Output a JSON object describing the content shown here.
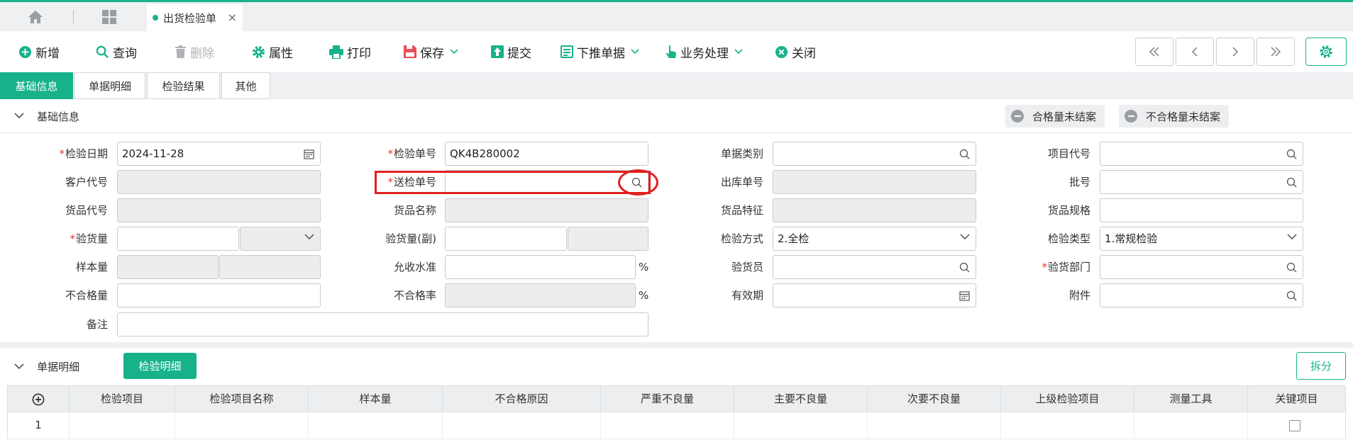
{
  "colors": {
    "accent": "#17b28a",
    "required": "#e53935",
    "highlight": "#e02020"
  },
  "tabbar": {
    "home_icon": "home-icon",
    "apps_icon": "grid-icon",
    "document_tab": {
      "label": "出货检验单",
      "close": "×"
    }
  },
  "toolbar": {
    "new": "新增",
    "query": "查询",
    "delete": "删除",
    "properties": "属性",
    "print": "打印",
    "save": "保存",
    "submit": "提交",
    "push_down": "下推单据",
    "business": "业务处理",
    "close": "关闭"
  },
  "subtabs": [
    "基础信息",
    "单据明细",
    "检验结果",
    "其他"
  ],
  "basic": {
    "title": "基础信息",
    "status_pass": "合格量未结案",
    "status_fail": "不合格量未结案"
  },
  "fields": {
    "inspect_date": {
      "label": "检验日期",
      "value": "2024-11-28"
    },
    "inspect_no": {
      "label": "检验单号",
      "value": "QK4B280002"
    },
    "doc_type": {
      "label": "单据类别",
      "value": ""
    },
    "project_code": {
      "label": "项目代号",
      "value": ""
    },
    "customer_code": {
      "label": "客户代号",
      "value": ""
    },
    "submit_no": {
      "label": "送检单号",
      "value": ""
    },
    "outbound_no": {
      "label": "出库单号",
      "value": ""
    },
    "batch_no": {
      "label": "批号",
      "value": ""
    },
    "goods_code": {
      "label": "货品代号",
      "value": ""
    },
    "goods_name": {
      "label": "货品名称",
      "value": ""
    },
    "goods_feature": {
      "label": "货品特征",
      "value": ""
    },
    "goods_spec": {
      "label": "货品规格",
      "value": ""
    },
    "inspect_qty": {
      "label": "验货量",
      "value": ""
    },
    "inspect_qty_sub": {
      "label": "验货量(副)",
      "value": ""
    },
    "inspect_method": {
      "label": "检验方式",
      "value": "2.全检"
    },
    "inspect_type": {
      "label": "检验类型",
      "value": "1.常规检验"
    },
    "sample_qty": {
      "label": "样本量",
      "value": ""
    },
    "aql": {
      "label": "允收水准",
      "value": "",
      "unit": "%"
    },
    "inspector": {
      "label": "验货员",
      "value": ""
    },
    "inspect_dept": {
      "label": "验货部门",
      "value": ""
    },
    "defect_qty": {
      "label": "不合格量",
      "value": ""
    },
    "defect_rate": {
      "label": "不合格率",
      "value": "",
      "unit": "%"
    },
    "valid_period": {
      "label": "有效期",
      "value": ""
    },
    "attachment": {
      "label": "附件",
      "value": ""
    },
    "remark": {
      "label": "备注",
      "value": ""
    }
  },
  "detail": {
    "title": "单据明细",
    "tab": "检验明细",
    "split": "拆分",
    "columns": [
      "检验项目",
      "检验项目名称",
      "样本量",
      "不合格原因",
      "严重不良量",
      "主要不良量",
      "次要不良量",
      "上级检验项目",
      "测量工具",
      "关键项目"
    ],
    "rows": [
      {
        "index": "1"
      }
    ]
  }
}
